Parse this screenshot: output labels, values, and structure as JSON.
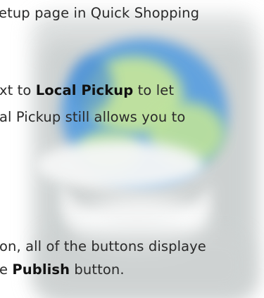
{
  "article": {
    "line_1": "etup page in Quick Shopping",
    "line_2_prefix": "xt to ",
    "line_2_bold": "Local Pickup",
    "line_2_suffix": " to let",
    "line_3": "al Pickup still allows you to",
    "line_4": "on, all of the buttons displaye",
    "line_5_prefix": "e ",
    "line_5_bold": "Publish",
    "line_5_suffix": " button."
  },
  "colors": {
    "text": "#2a2a2a",
    "bold_text": "#111111",
    "illustration_green": "#bfe39a",
    "illustration_blue": "#4c8fd6",
    "illustration_gray": "#cfd3d3"
  }
}
